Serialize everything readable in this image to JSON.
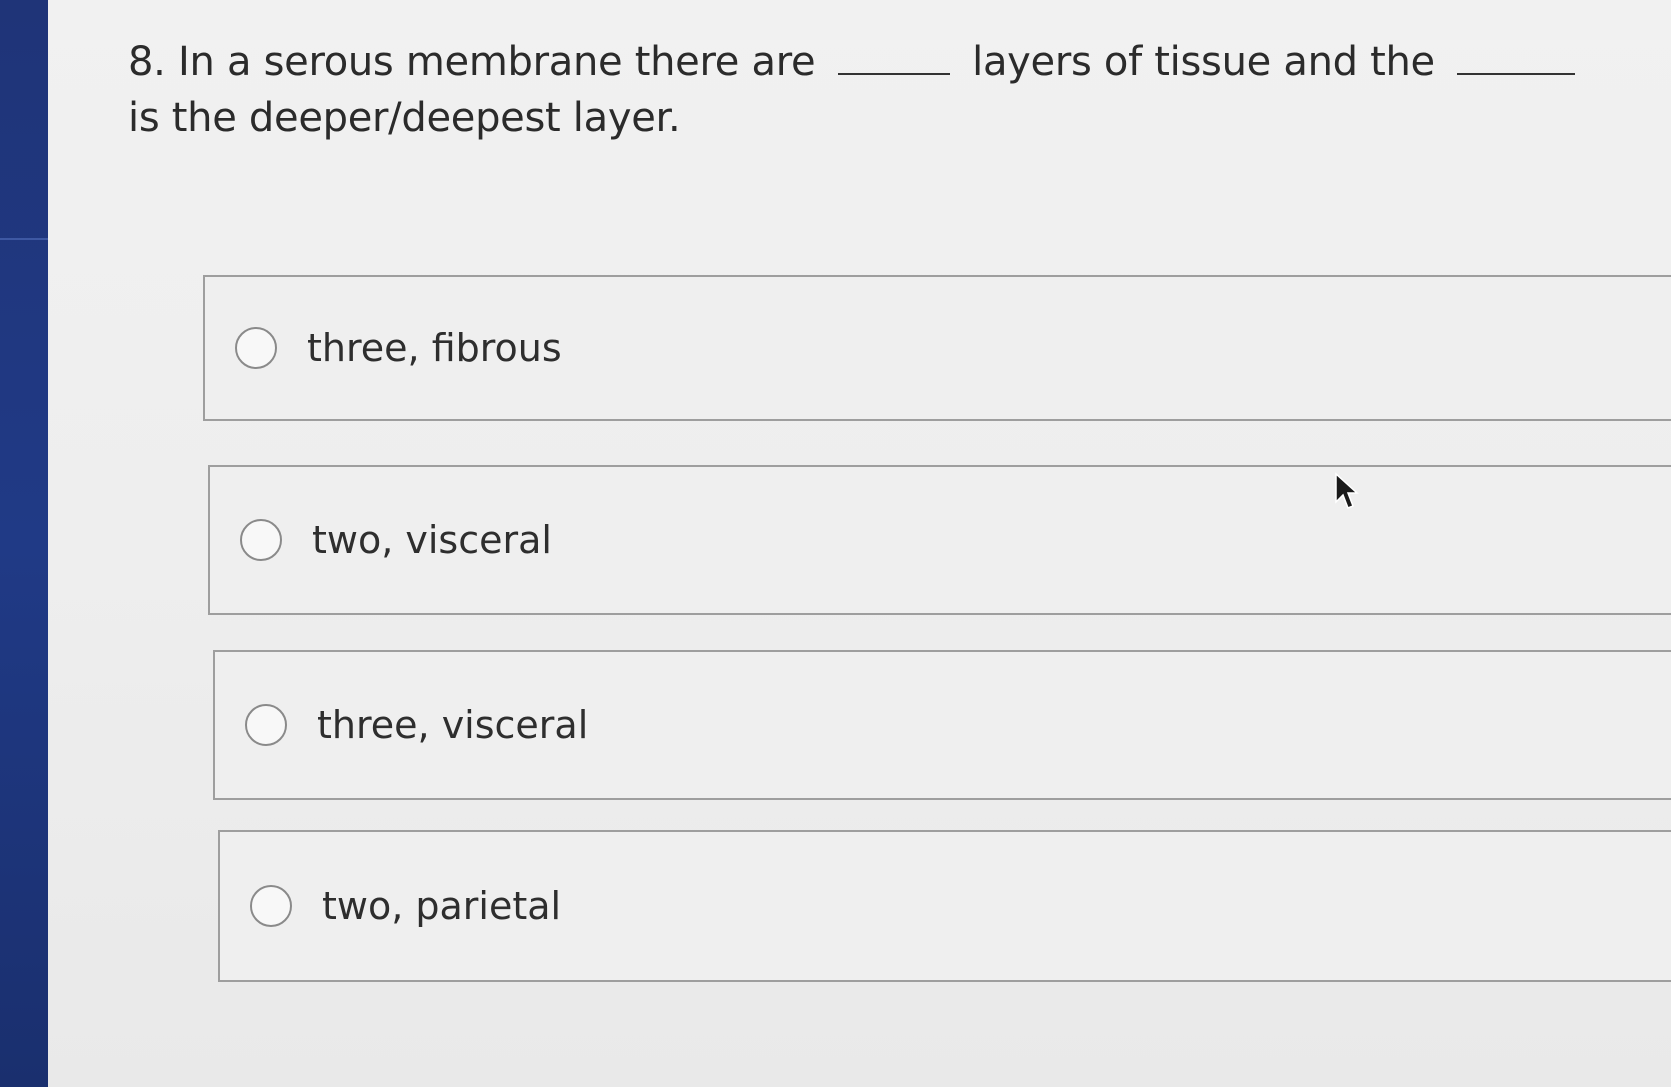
{
  "question": {
    "number": "8.",
    "text_part1": "In a serous membrane there are",
    "text_part2": "layers of tissue and the",
    "text_part3": "is the deeper/deepest layer."
  },
  "options": [
    {
      "label": "three, fibrous",
      "selected": false
    },
    {
      "label": "two, visceral",
      "selected": false
    },
    {
      "label": "three, visceral",
      "selected": false
    },
    {
      "label": "two, parietal",
      "selected": false
    }
  ],
  "icons": {
    "cursor": "mouse-pointer-icon",
    "radio": "radio-button-icon"
  },
  "colors": {
    "sidebar": "#203a86",
    "background": "#eeeeee",
    "border": "#9e9e9e",
    "text": "#2b2b2b"
  }
}
